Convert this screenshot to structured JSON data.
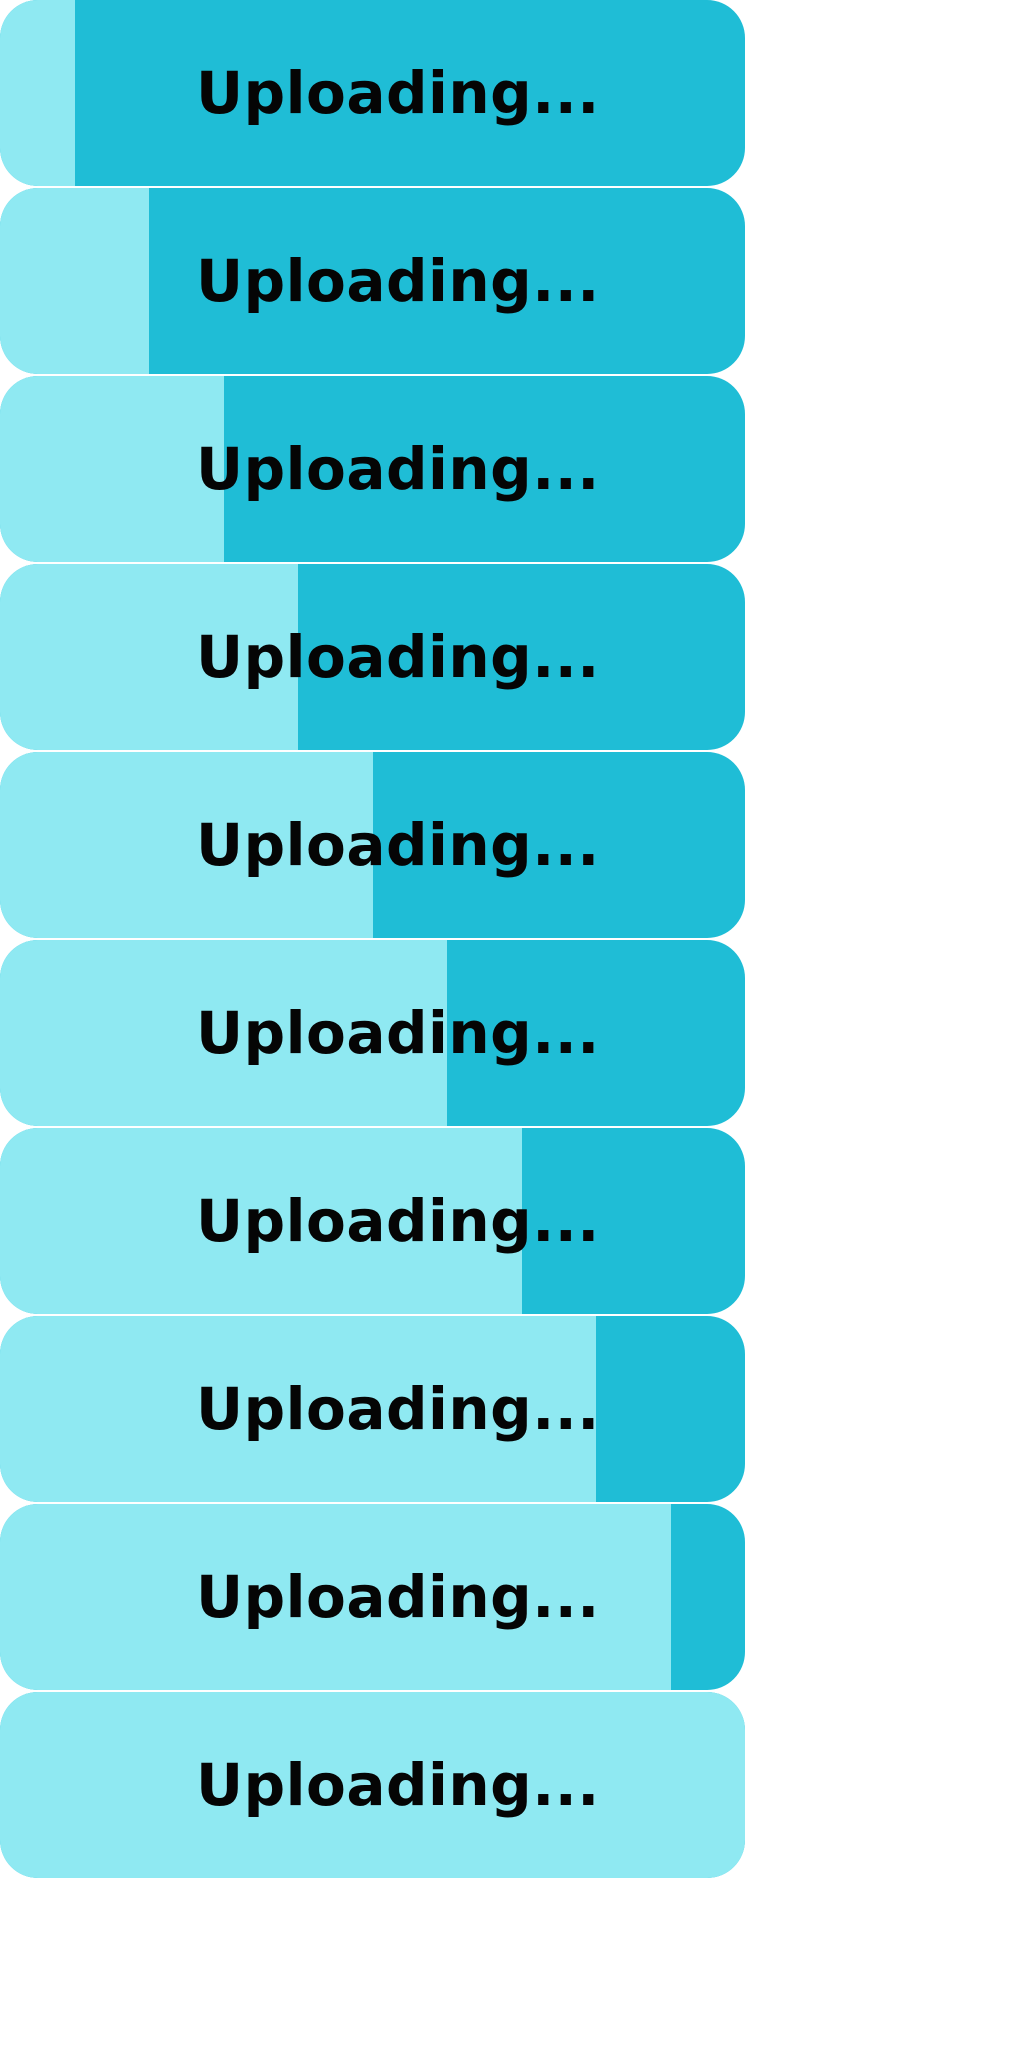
{
  "label": "Uploading...",
  "colors": {
    "fill": "#8fe9f2",
    "track": "#1fbdd6",
    "text": "#050505"
  },
  "bars": [
    {
      "progress": 0.1
    },
    {
      "progress": 0.2
    },
    {
      "progress": 0.3
    },
    {
      "progress": 0.4
    },
    {
      "progress": 0.5
    },
    {
      "progress": 0.6
    },
    {
      "progress": 0.7
    },
    {
      "progress": 0.8
    },
    {
      "progress": 0.9
    },
    {
      "progress": 1.0
    }
  ]
}
